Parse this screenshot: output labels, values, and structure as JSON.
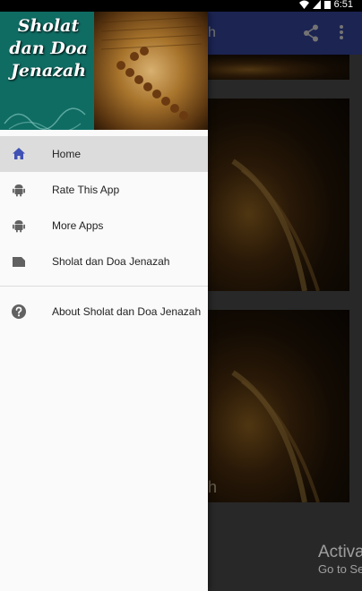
{
  "status_bar": {
    "time": "6:51"
  },
  "app_bar": {
    "title_fragment": "h"
  },
  "content": {
    "card_caption": "h"
  },
  "drawer": {
    "header": {
      "title_line1": "Sholat",
      "title_line2": "dan Doa",
      "title_line3": "Jenazah"
    },
    "menu": [
      {
        "label": "Home",
        "icon": "home-icon",
        "active": true
      },
      {
        "label": "Rate This App",
        "icon": "android-icon",
        "active": false
      },
      {
        "label": "More Apps",
        "icon": "android-icon",
        "active": false
      },
      {
        "label": "Sholat dan Doa Jenazah",
        "icon": "folder-icon",
        "active": false
      }
    ],
    "secondary_menu": [
      {
        "label": "About Sholat dan Doa Jenazah",
        "icon": "help-icon"
      }
    ]
  },
  "watermark": {
    "line1": "Activate Windows",
    "line2": "Go to Settings"
  },
  "colors": {
    "primary": "#3f51b5",
    "active_icon": "#3f51b5",
    "icon_gray": "#616161"
  }
}
